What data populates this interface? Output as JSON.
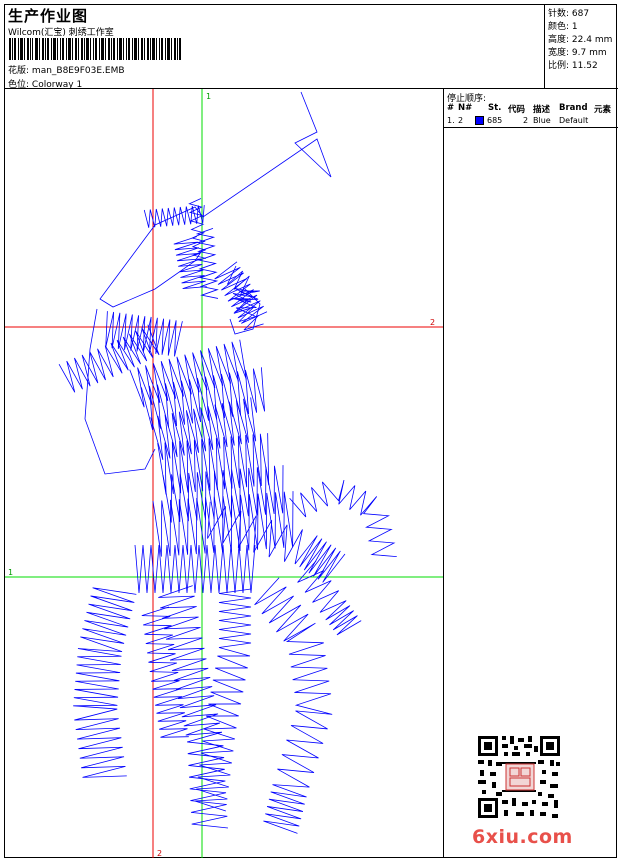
{
  "header": {
    "title": "生产作业图",
    "company": "Wilcom(汇宝) 刺绣工作室",
    "design_label": "花版:",
    "design_name": "man_B8E9F03E.EMB",
    "colorway_label": "色位:",
    "colorway_name": "Colorway 1"
  },
  "stats": {
    "stitches_label": "针数:",
    "stitches": "687",
    "colors_label": "颜色:",
    "colors": "1",
    "height_label": "高度:",
    "height": "22.4 mm",
    "width_label": "宽度:",
    "width": "9.7 mm",
    "scale_label": "比例:",
    "scale": "11.52"
  },
  "stop_sequence": {
    "title": "停止顺序:",
    "columns": [
      "#",
      "N#",
      "St.",
      "代码",
      "描述",
      "Brand",
      "元素"
    ],
    "rows": [
      {
        "index": "1.",
        "needle": "2",
        "color": "#0000ff",
        "stitches": "685",
        "code": "2",
        "description": "Blue",
        "brand": "Default",
        "element": ""
      }
    ]
  },
  "guides": {
    "v1": "1",
    "v2": "2",
    "h1": "1",
    "h2": "2",
    "v1_color": "#00dd00",
    "v2_color": "#ee0000",
    "stitch_color": "#0000ff"
  },
  "watermark": "6xiu.com"
}
